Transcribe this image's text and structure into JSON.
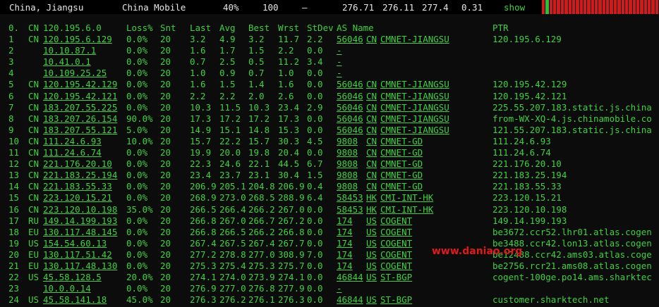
{
  "summary": {
    "location": "China, Jiangsu",
    "isp": "China Mobile",
    "loss": "40%",
    "sent": "100",
    "dash": "–",
    "v1": "276.71",
    "v2": "276.11",
    "v3": "277.4",
    "v4": "0.31",
    "show_label": "show"
  },
  "history_bar": [
    "red",
    "green",
    "red",
    "red",
    "red",
    "red",
    "red",
    "red",
    "red",
    "red",
    "red",
    "red",
    "red",
    "red",
    "red",
    "red",
    "red",
    "red",
    "red",
    "red",
    "red",
    "red",
    "red",
    "red",
    "red",
    "red",
    "red",
    "red",
    "red",
    "red",
    "red"
  ],
  "headers": {
    "idx": "0.",
    "cc": "CN",
    "host": "120.195.6.0",
    "loss": "Loss%",
    "snt": "Snt",
    "last": "Last",
    "avg": "Avg",
    "best": "Best",
    "wrst": "Wrst",
    "stdev": "StDev",
    "as": "AS Name",
    "ptr": "PTR"
  },
  "rows": [
    {
      "idx": "1",
      "cc": "CN",
      "host": "120.195.6.129",
      "loss": "0.0%",
      "snt": "20",
      "last": "3.2",
      "avg": "4.9",
      "best": "3.2",
      "wrst": "11.7",
      "stdev": "2.2",
      "asn": "56046",
      "ascc": "CN",
      "asname": "CMNET-JIANGSU",
      "ptr": "120.195.6.129"
    },
    {
      "idx": "2",
      "cc": "",
      "host": "10.10.87.1",
      "loss": "0.0%",
      "snt": "20",
      "last": "1.6",
      "avg": "1.7",
      "best": "1.5",
      "wrst": "2.2",
      "stdev": "0.0",
      "asn": "-",
      "ascc": "",
      "asname": "",
      "ptr": ""
    },
    {
      "idx": "3",
      "cc": "",
      "host": "10.41.0.1",
      "loss": "0.0%",
      "snt": "20",
      "last": "0.7",
      "avg": "2.5",
      "best": "0.5",
      "wrst": "11.2",
      "stdev": "3.4",
      "asn": "-",
      "ascc": "",
      "asname": "",
      "ptr": ""
    },
    {
      "idx": "4",
      "cc": "",
      "host": "10.109.25.25",
      "loss": "0.0%",
      "snt": "20",
      "last": "1.0",
      "avg": "0.9",
      "best": "0.7",
      "wrst": "1.0",
      "stdev": "0.0",
      "asn": "-",
      "ascc": "",
      "asname": "",
      "ptr": ""
    },
    {
      "idx": "5",
      "cc": "CN",
      "host": "120.195.42.129",
      "loss": "0.0%",
      "snt": "20",
      "last": "1.6",
      "avg": "1.5",
      "best": "1.4",
      "wrst": "1.6",
      "stdev": "0.0",
      "asn": "56046",
      "ascc": "CN",
      "asname": "CMNET-JIANGSU",
      "ptr": "120.195.42.129"
    },
    {
      "idx": "6",
      "cc": "CN",
      "host": "120.195.42.121",
      "loss": "0.0%",
      "snt": "20",
      "last": "2.2",
      "avg": "2.2",
      "best": "2.0",
      "wrst": "2.6",
      "stdev": "0.0",
      "asn": "56046",
      "ascc": "CN",
      "asname": "CMNET-JIANGSU",
      "ptr": "120.195.42.121"
    },
    {
      "idx": "7",
      "cc": "CN",
      "host": "183.207.55.225",
      "loss": "0.0%",
      "snt": "20",
      "last": "10.3",
      "avg": "11.5",
      "best": "10.3",
      "wrst": "23.4",
      "stdev": "2.9",
      "asn": "56046",
      "ascc": "CN",
      "asname": "CMNET-JIANGSU",
      "ptr": "225.55.207.183.static.js.china"
    },
    {
      "idx": "8",
      "cc": "CN",
      "host": "183.207.26.154",
      "loss": "90.0%",
      "snt": "20",
      "last": "17.3",
      "avg": "17.2",
      "best": "17.2",
      "wrst": "17.3",
      "stdev": "0.0",
      "asn": "56046",
      "ascc": "CN",
      "asname": "CMNET-JIANGSU",
      "ptr": "from-WX-XQ-4.js.chinamobile.co"
    },
    {
      "idx": "9",
      "cc": "CN",
      "host": "183.207.55.121",
      "loss": "5.0%",
      "snt": "20",
      "last": "14.9",
      "avg": "15.1",
      "best": "14.8",
      "wrst": "15.3",
      "stdev": "0.0",
      "asn": "56046",
      "ascc": "CN",
      "asname": "CMNET-JIANGSU",
      "ptr": "121.55.207.183.static.js.china"
    },
    {
      "idx": "10",
      "cc": "CN",
      "host": "111.24.6.93",
      "loss": "10.0%",
      "snt": "20",
      "last": "15.7",
      "avg": "22.2",
      "best": "15.7",
      "wrst": "30.3",
      "stdev": "4.5",
      "asn": "9808",
      "ascc": "CN",
      "asname": "CMNET-GD",
      "ptr": "111.24.6.93"
    },
    {
      "idx": "11",
      "cc": "CN",
      "host": "111.24.6.74",
      "loss": "0.0%",
      "snt": "20",
      "last": "19.9",
      "avg": "20.0",
      "best": "19.8",
      "wrst": "20.4",
      "stdev": "0.0",
      "asn": "9808",
      "ascc": "CN",
      "asname": "CMNET-GD",
      "ptr": "111.24.6.74"
    },
    {
      "idx": "12",
      "cc": "CN",
      "host": "221.176.20.10",
      "loss": "0.0%",
      "snt": "20",
      "last": "22.3",
      "avg": "24.6",
      "best": "22.1",
      "wrst": "44.5",
      "stdev": "6.7",
      "asn": "9808",
      "ascc": "CN",
      "asname": "CMNET-GD",
      "ptr": "221.176.20.10"
    },
    {
      "idx": "13",
      "cc": "CN",
      "host": "221.183.25.194",
      "loss": "0.0%",
      "snt": "20",
      "last": "23.4",
      "avg": "23.7",
      "best": "23.1",
      "wrst": "30.4",
      "stdev": "1.5",
      "asn": "9808",
      "ascc": "CN",
      "asname": "CMNET-GD",
      "ptr": "221.183.25.194"
    },
    {
      "idx": "14",
      "cc": "CN",
      "host": "221.183.55.33",
      "loss": "0.0%",
      "snt": "20",
      "last": "206.9",
      "avg": "205.1",
      "best": "204.8",
      "wrst": "206.9",
      "stdev": "0.4",
      "asn": "9808",
      "ascc": "CN",
      "asname": "CMNET-GD",
      "ptr": "221.183.55.33"
    },
    {
      "idx": "15",
      "cc": "CN",
      "host": "223.120.15.21",
      "loss": "0.0%",
      "snt": "20",
      "last": "268.9",
      "avg": "273.0",
      "best": "268.5",
      "wrst": "288.9",
      "stdev": "6.4",
      "asn": "58453",
      "ascc": "HK",
      "asname": "CMI-INT-HK",
      "ptr": "223.120.15.21"
    },
    {
      "idx": "16",
      "cc": "CN",
      "host": "223.120.10.198",
      "loss": "35.0%",
      "snt": "20",
      "last": "266.5",
      "avg": "266.4",
      "best": "266.2",
      "wrst": "267.0",
      "stdev": "0.0",
      "asn": "58453",
      "ascc": "HK",
      "asname": "CMI-INT-HK",
      "ptr": "223.120.10.198"
    },
    {
      "idx": "17",
      "cc": "RU",
      "host": "149.14.199.193",
      "loss": "0.0%",
      "snt": "20",
      "last": "266.8",
      "avg": "267.0",
      "best": "266.7",
      "wrst": "267.2",
      "stdev": "0.0",
      "asn": "174",
      "ascc": "US",
      "asname": "COGENT",
      "ptr": "149.14.199.193"
    },
    {
      "idx": "18",
      "cc": "EU",
      "host": "130.117.48.145",
      "loss": "0.0%",
      "snt": "20",
      "last": "266.8",
      "avg": "266.5",
      "best": "266.2",
      "wrst": "266.8",
      "stdev": "0.0",
      "asn": "174",
      "ascc": "US",
      "asname": "COGENT",
      "ptr": "be3672.ccr52.lhr01.atlas.cogen"
    },
    {
      "idx": "19",
      "cc": "US",
      "host": "154.54.60.13",
      "loss": "0.0%",
      "snt": "20",
      "last": "267.4",
      "avg": "267.5",
      "best": "267.4",
      "wrst": "267.7",
      "stdev": "0.0",
      "asn": "174",
      "ascc": "US",
      "asname": "COGENT",
      "ptr": "be3488.ccr42.lon13.atlas.cogen"
    },
    {
      "idx": "20",
      "cc": "EU",
      "host": "130.117.51.42",
      "loss": "0.0%",
      "snt": "20",
      "last": "277.2",
      "avg": "278.8",
      "best": "277.0",
      "wrst": "308.9",
      "stdev": "7.0",
      "asn": "174",
      "ascc": "US",
      "asname": "COGENT",
      "ptr": "be12488.ccr42.ams03.atlas.coge"
    },
    {
      "idx": "21",
      "cc": "EU",
      "host": "130.117.48.130",
      "loss": "0.0%",
      "snt": "20",
      "last": "275.3",
      "avg": "275.4",
      "best": "275.3",
      "wrst": "275.7",
      "stdev": "0.0",
      "asn": "174",
      "ascc": "US",
      "asname": "COGENT",
      "ptr": "be2756.rcr21.ams08.atlas.cogen"
    },
    {
      "idx": "22",
      "cc": "US",
      "host": "45.58.128.5",
      "loss": "20.0%",
      "snt": "20",
      "last": "274.1",
      "avg": "274.0",
      "best": "273.9",
      "wrst": "274.1",
      "stdev": "0.0",
      "asn": "46844",
      "ascc": "US",
      "asname": "ST-BGP",
      "ptr": "cogent-100ge.po14.ams.sharktec"
    },
    {
      "idx": "23",
      "cc": "",
      "host": "10.0.0.14",
      "loss": "0.0%",
      "snt": "20",
      "last": "276.9",
      "avg": "277.0",
      "best": "276.8",
      "wrst": "277.9",
      "stdev": "0.0",
      "asn": "-",
      "ascc": "",
      "asname": "",
      "ptr": ""
    },
    {
      "idx": "24",
      "cc": "US",
      "host": "45.58.141.18",
      "loss": "45.0%",
      "snt": "20",
      "last": "276.3",
      "avg": "276.2",
      "best": "276.1",
      "wrst": "276.3",
      "stdev": "0.0",
      "asn": "46844",
      "ascc": "US",
      "asname": "ST-BGP",
      "ptr": "customer.sharktech.net"
    }
  ],
  "watermark": "www.daniao.org"
}
